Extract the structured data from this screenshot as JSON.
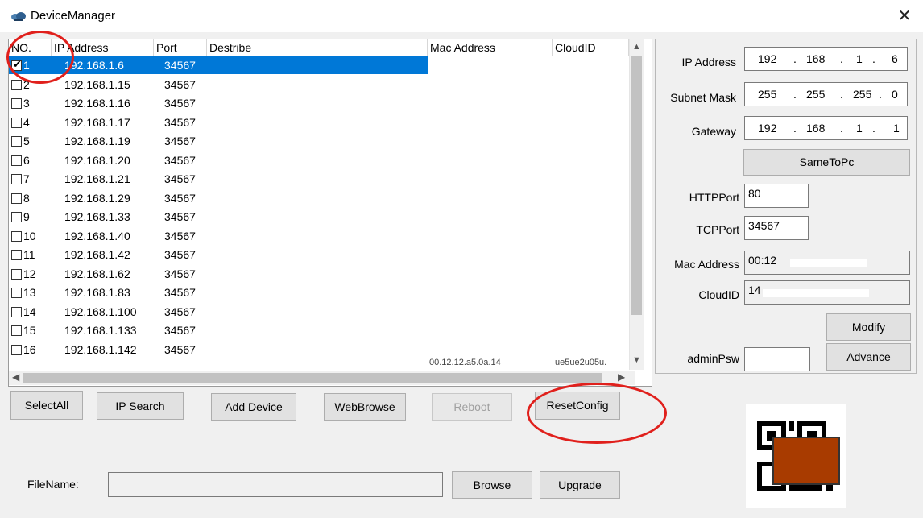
{
  "window": {
    "title": "DeviceManager",
    "close_glyph": "✕"
  },
  "table": {
    "headers": [
      "NO.",
      "IP Address",
      "Port",
      "Destribe",
      "Mac Address",
      "CloudID"
    ],
    "rows": [
      {
        "no": "1",
        "ip": "192.168.1.6",
        "port": "34567",
        "checked": true,
        "selected": true
      },
      {
        "no": "2",
        "ip": "192.168.1.15",
        "port": "34567",
        "checked": false
      },
      {
        "no": "3",
        "ip": "192.168.1.16",
        "port": "34567",
        "checked": false
      },
      {
        "no": "4",
        "ip": "192.168.1.17",
        "port": "34567",
        "checked": false
      },
      {
        "no": "5",
        "ip": "192.168.1.19",
        "port": "34567",
        "checked": false
      },
      {
        "no": "6",
        "ip": "192.168.1.20",
        "port": "34567",
        "checked": false
      },
      {
        "no": "7",
        "ip": "192.168.1.21",
        "port": "34567",
        "checked": false
      },
      {
        "no": "8",
        "ip": "192.168.1.29",
        "port": "34567",
        "checked": false
      },
      {
        "no": "9",
        "ip": "192.168.1.33",
        "port": "34567",
        "checked": false
      },
      {
        "no": "10",
        "ip": "192.168.1.40",
        "port": "34567",
        "checked": false
      },
      {
        "no": "11",
        "ip": "192.168.1.42",
        "port": "34567",
        "checked": false
      },
      {
        "no": "12",
        "ip": "192.168.1.62",
        "port": "34567",
        "checked": false
      },
      {
        "no": "13",
        "ip": "192.168.1.83",
        "port": "34567",
        "checked": false
      },
      {
        "no": "14",
        "ip": "192.168.1.100",
        "port": "34567",
        "checked": false
      },
      {
        "no": "15",
        "ip": "192.168.1.133",
        "port": "34567",
        "checked": false
      },
      {
        "no": "16",
        "ip": "192.168.1.142",
        "port": "34567",
        "checked": false
      }
    ],
    "last_row_mac_partial": "00.12.12.a5.0a.14",
    "last_row_cloud_partial": "ue5ue2u05u."
  },
  "panel": {
    "ip_label": "IP Address",
    "ip": [
      "192",
      "168",
      "1",
      "6"
    ],
    "mask_label": "Subnet Mask",
    "mask": [
      "255",
      "255",
      "255",
      "0"
    ],
    "gw_label": "Gateway",
    "gw": [
      "192",
      "168",
      "1",
      "1"
    ],
    "same_to_pc": "SameToPc",
    "http_label": "HTTPPort",
    "http_value": "80",
    "tcp_label": "TCPPort",
    "tcp_value": "34567",
    "mac_label": "Mac Address",
    "mac_value": "00:12",
    "cloud_label": "CloudID",
    "cloud_value": "14",
    "modify": "Modify",
    "admin_label": "adminPsw",
    "admin_value": "",
    "advance": "Advance",
    "dot": "."
  },
  "buttons": {
    "select_all": "SelectAll",
    "ip_search": "IP Search",
    "add_device": "Add Device",
    "web_browse": "WebBrowse",
    "reboot": "Reboot",
    "reset_config": "ResetConfig",
    "browse": "Browse",
    "upgrade": "Upgrade"
  },
  "file": {
    "label": "FileName:",
    "value": ""
  },
  "colors": {
    "selection": "#0078d7",
    "annotation": "#e0201c",
    "qr_cover": "#a83b00"
  }
}
